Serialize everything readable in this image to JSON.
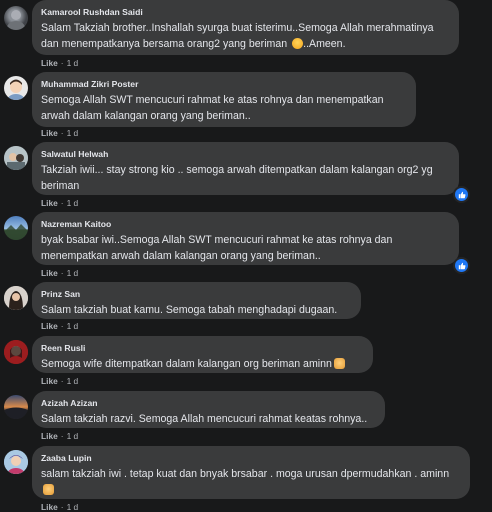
{
  "comments": [
    {
      "author": "Kamarool Rushdan Saidi",
      "text": "Salam Takziah brother..Inshallah syurga buat isterimu..Semoga Allah merahmatinya dan menempatkanya bersama orang2 yang beriman",
      "text_suffix": "..Ameen.",
      "emoji": "crying-face-emoji",
      "like": "Like",
      "time": "1 d"
    },
    {
      "author": "Muhammad Zikri Poster",
      "text": "Semoga Allah SWT mencucuri rahmat ke atas rohnya dan menempatkan arwah dalam kalangan orang yang beriman..",
      "like": "Like",
      "time": "1 d"
    },
    {
      "author": "Salwatul Helwah",
      "text": "Takziah iwii... stay strong kio .. semoga arwah ditempatkan dalam kalangan org2 yg beriman",
      "like": "Like",
      "time": "1 d",
      "reaction": "like-reaction-icon"
    },
    {
      "author": "Nazreman Kaitoo",
      "text": "byak bsabar iwi..Semoga Allah SWT mencucuri rahmat ke atas rohnya dan menempatkan arwah dalam kalangan orang yang beriman..",
      "like": "Like",
      "time": "1 d",
      "reaction": "like-reaction-icon"
    },
    {
      "author": "Prinz San",
      "text": "Salam takziah buat kamu. Semoga tabah menghadapi dugaan.",
      "like": "Like",
      "time": "1 d"
    },
    {
      "author": "Reen Rusli",
      "text": "Semoga wife ditempatkan dalam kalangan org beriman aminn",
      "emoji": "praying-hands-emoji",
      "like": "Like",
      "time": "1 d"
    },
    {
      "author": "Azizah Azizan",
      "text": "Salam takziah razvi. Semoga Allah mencucuri rahmat keatas rohnya..",
      "like": "Like",
      "time": "1 d"
    },
    {
      "author": "Zaaba Lupin",
      "text": "salam takziah iwi . tetap kuat dan bnyak brsabar . moga urusan dpermudahkan . aminn",
      "emoji": "praying-hands-emoji",
      "like": "Like",
      "time": "1 d"
    }
  ],
  "colors": {
    "background": "#18191a",
    "bubble": "#3a3b3c",
    "text": "#e4e6eb",
    "muted": "#b0b3b8",
    "reaction": "#2078f4"
  }
}
